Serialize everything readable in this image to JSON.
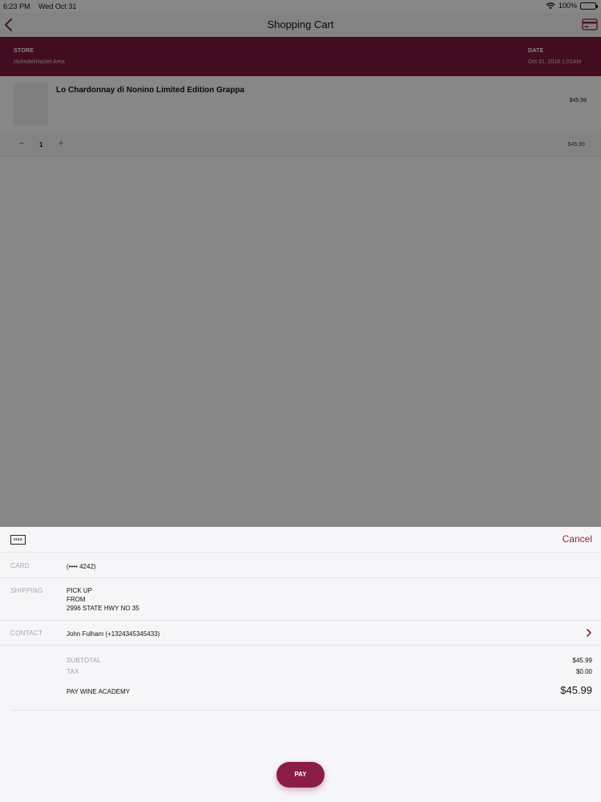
{
  "status_bar": {
    "time": "6:23 PM",
    "date": "Wed Oct 31",
    "battery": "100%"
  },
  "nav": {
    "title": "Shopping Cart"
  },
  "store_band": {
    "store_label": "STORE",
    "store_value": "Holmdel/Hazlet Area",
    "date_label": "DATE",
    "date_value": "Oct 31, 2018 1:01AM"
  },
  "cart": {
    "items": [
      {
        "name": "Lo Chardonnay di Nonino Limited Edition Grappa",
        "price": "$45.99",
        "quantity": "1",
        "line_total": "$45.99"
      }
    ],
    "minus_label": "−",
    "plus_label": "+"
  },
  "payment_sheet": {
    "card_brand": "VISA",
    "cancel_label": "Cancel",
    "card_label": "CARD",
    "card_value": "(•••• 4242)",
    "shipping_label": "SHIPPING",
    "shipping_lines": [
      "PICK UP",
      "FROM",
      "2996 STATE HWY NO 35"
    ],
    "contact_label": "CONTACT",
    "contact_value": "John Fulham (+1324345345433)",
    "subtotal_label": "SUBTOTAL",
    "subtotal_value": "$45.99",
    "tax_label": "TAX",
    "tax_value": "$0.00",
    "pay_to_label": "PAY WINE ACADEMY",
    "total_value": "$45.99",
    "pay_button_label": "PAY"
  },
  "colors": {
    "brand": "#7e1a3f",
    "accent": "#8e1f45",
    "pay_button": "#8a1c47"
  }
}
